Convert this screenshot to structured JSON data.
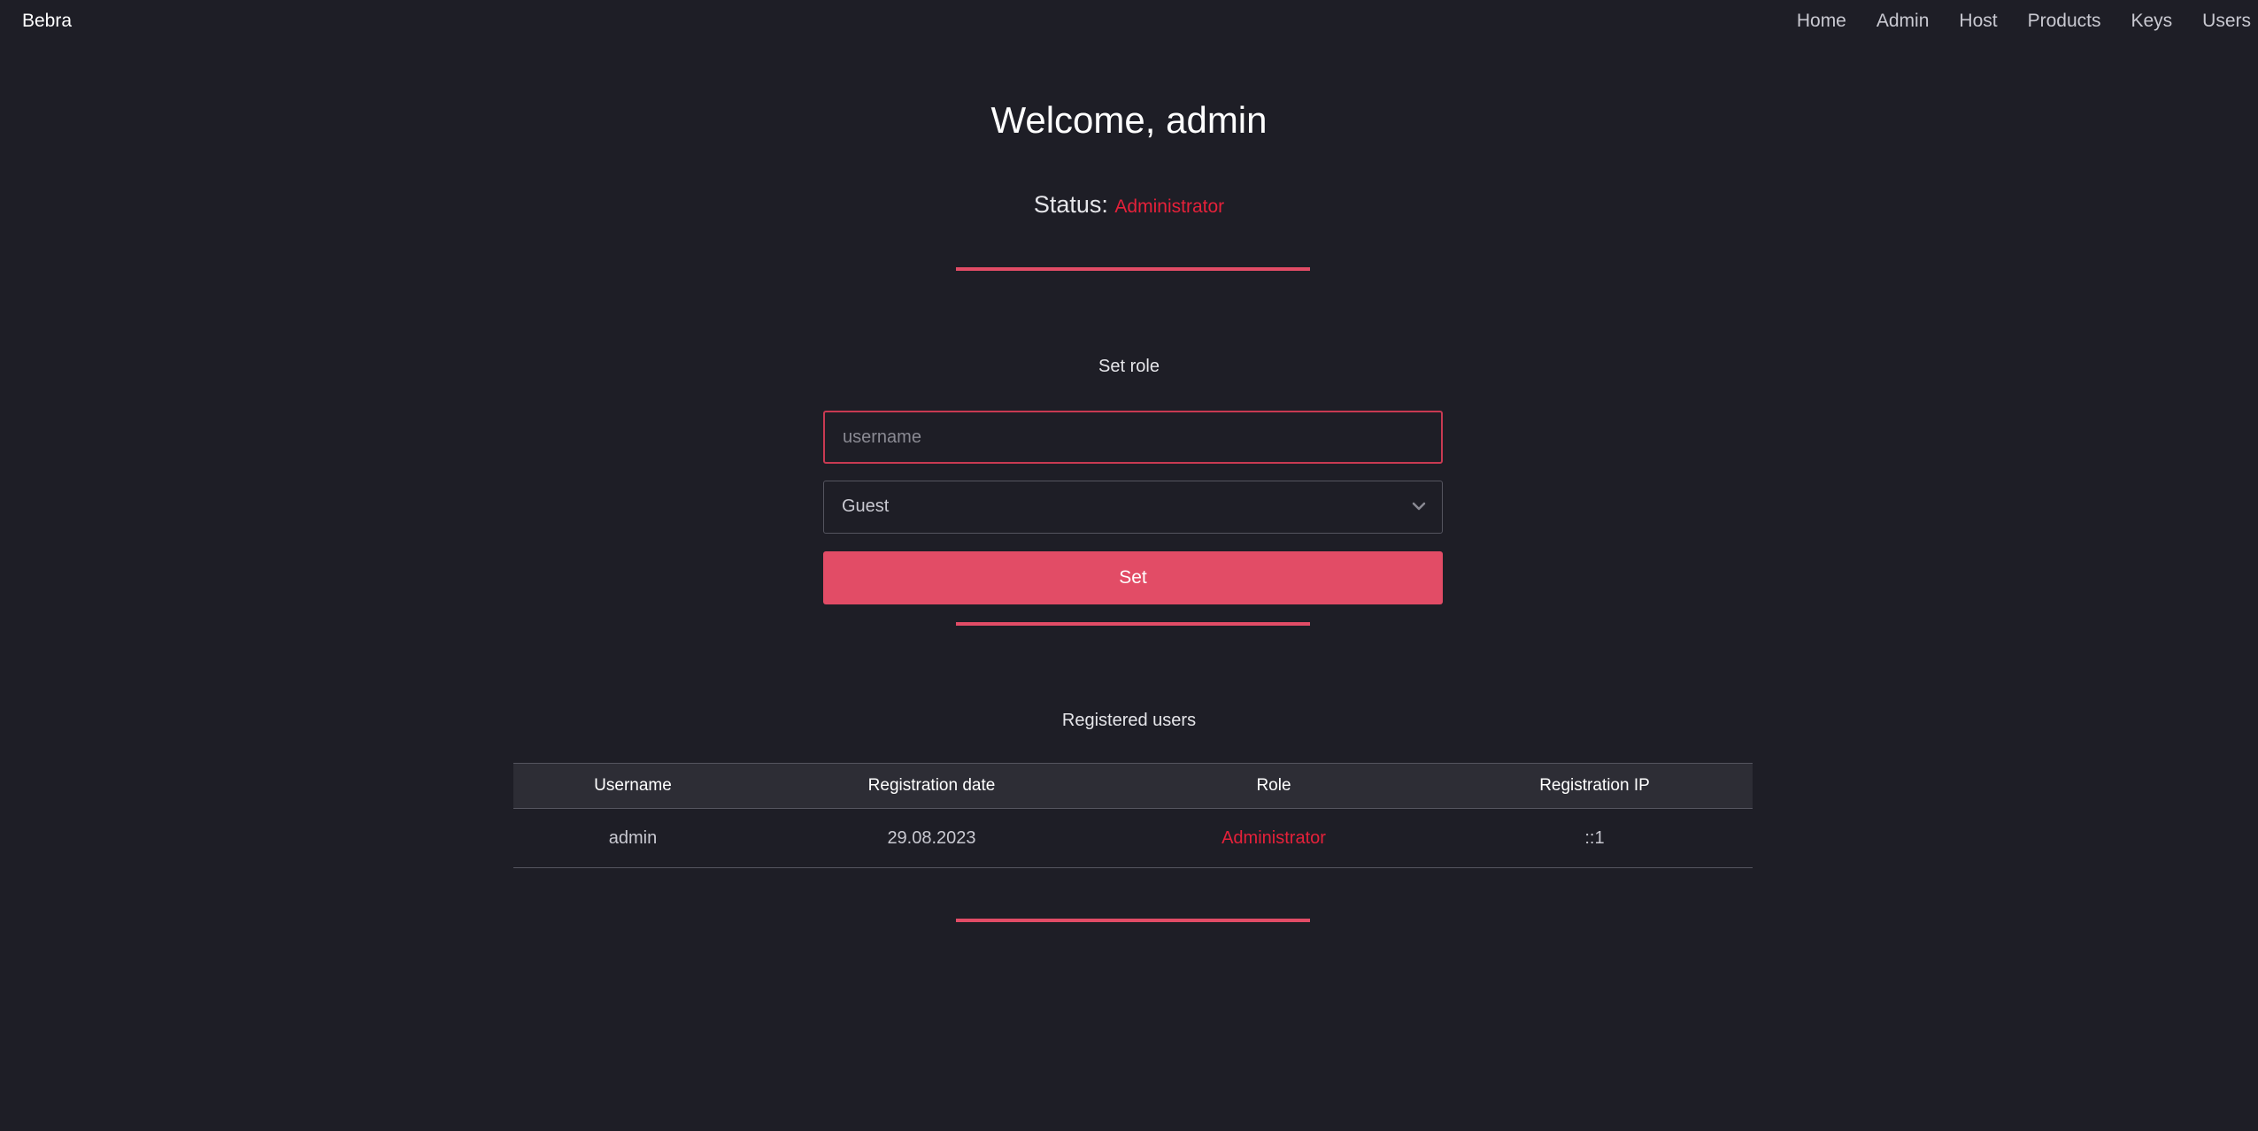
{
  "nav": {
    "brand": "Bebra",
    "links": [
      "Home",
      "Admin",
      "Host",
      "Products",
      "Keys",
      "Users"
    ]
  },
  "welcome": {
    "title": "Welcome, admin",
    "status_label": "Status:",
    "status_value": "Administrator"
  },
  "set_role": {
    "title": "Set role",
    "username_placeholder": "username",
    "role_value": "Guest",
    "button_label": "Set"
  },
  "registered_users": {
    "title": "Registered users",
    "columns": [
      "Username",
      "Registration date",
      "Role",
      "Registration IP"
    ],
    "rows": [
      [
        "admin",
        "29.08.2023",
        "Administrator",
        "::1"
      ]
    ]
  },
  "colors": {
    "background": "#1e1e26",
    "accent": "#e24c66",
    "status_red": "#e5213a"
  }
}
